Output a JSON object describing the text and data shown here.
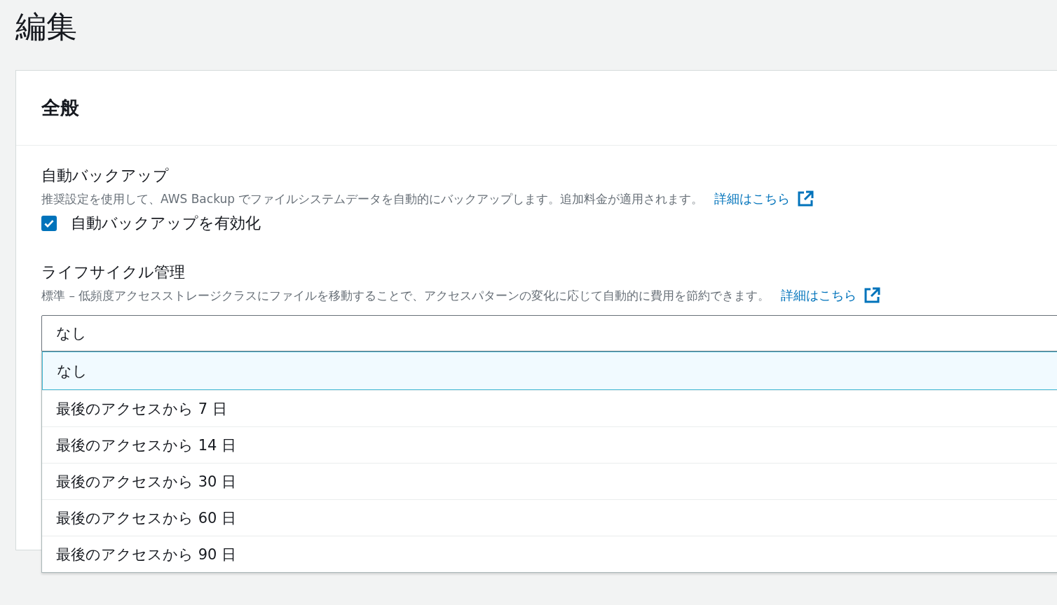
{
  "page_title": "編集",
  "section": {
    "title": "全般",
    "fields": [
      {
        "kind": "checkbox",
        "label": "自動バックアップ",
        "description": "推奨設定を使用して、AWS Backup でファイルシステムデータを自動的にバックアップします。追加料金が適用されます。",
        "link": "詳細はこちら",
        "checkbox": {
          "label": "自動バックアップを有効化",
          "checked": true
        }
      },
      {
        "kind": "select",
        "label": "ライフサイクル管理",
        "description": "標準 – 低頻度アクセスストレージクラスにファイルを移動することで、アクセスパターンの変化に応じて自動的に費用を節約できます。",
        "link": "詳細はこちら",
        "select": {
          "value": "なし",
          "expanded": true,
          "options": [
            {
              "label": "なし",
              "selected": true
            },
            {
              "label": "最後のアクセスから 7 日",
              "selected": false
            },
            {
              "label": "最後のアクセスから 14 日",
              "selected": false
            },
            {
              "label": "最後のアクセスから 30 日",
              "selected": false
            },
            {
              "label": "最後のアクセスから 60 日",
              "selected": false
            },
            {
              "label": "最後のアクセスから 90 日",
              "selected": false
            }
          ]
        }
      }
    ]
  }
}
